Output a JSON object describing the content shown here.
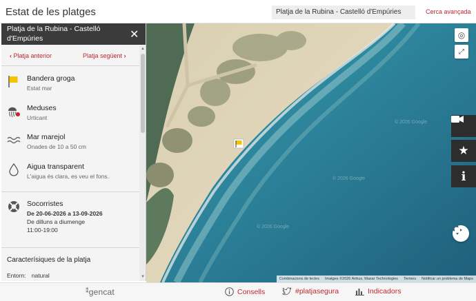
{
  "header": {
    "title": "Estat de les platges",
    "search_value": "Platja de la Rubina - Castelló d'Empúries",
    "advanced_search_label": "Cerca avançada"
  },
  "panel": {
    "title": "Platja de la Rubina - Castelló d'Empúries",
    "prev_label": "Platja anterior",
    "next_label": "Platja següent",
    "items": [
      {
        "icon": "yellow-flag-icon",
        "title": "Bandera groga",
        "subtitle": "Estat mar"
      },
      {
        "icon": "jellyfish-icon",
        "title": "Meduses",
        "subtitle": "Urticant"
      },
      {
        "icon": "waves-icon",
        "title": "Mar marejol",
        "subtitle": "Onades de 10 a 50 cm"
      },
      {
        "icon": "water-drop-icon",
        "title": "Aigua transparent",
        "subtitle": "L'aigua és clara, es veu el fons."
      }
    ],
    "lifeguard": {
      "title": "Socorristes",
      "dates": "De 20-06-2026 a 13-09-2026",
      "days": "De dilluns a diumenge",
      "hours": "11:00-19:00"
    },
    "features_title": "Caracterísiques de la platja",
    "features": [
      {
        "label": "Entorn:",
        "value": "natural"
      }
    ]
  },
  "map": {
    "attribution": [
      "Combinacions de tecles",
      "Imatges ©2026 Airbus, Maxar Technologies",
      "Termes",
      "Notificar un problema de Maps"
    ],
    "watermark": "© 2026 Google",
    "flag_color": "#f5c400"
  },
  "footer": {
    "logo": "gencat",
    "links": [
      {
        "icon": "info-icon",
        "label": "Consells"
      },
      {
        "icon": "twitter-icon",
        "label": "#platjasegura"
      },
      {
        "icon": "bar-chart-icon",
        "label": "Indicadors"
      }
    ]
  },
  "colors": {
    "accent": "#c0282d",
    "panel_header": "#3b3b3b",
    "side_buttons": "#2d2d2d"
  }
}
